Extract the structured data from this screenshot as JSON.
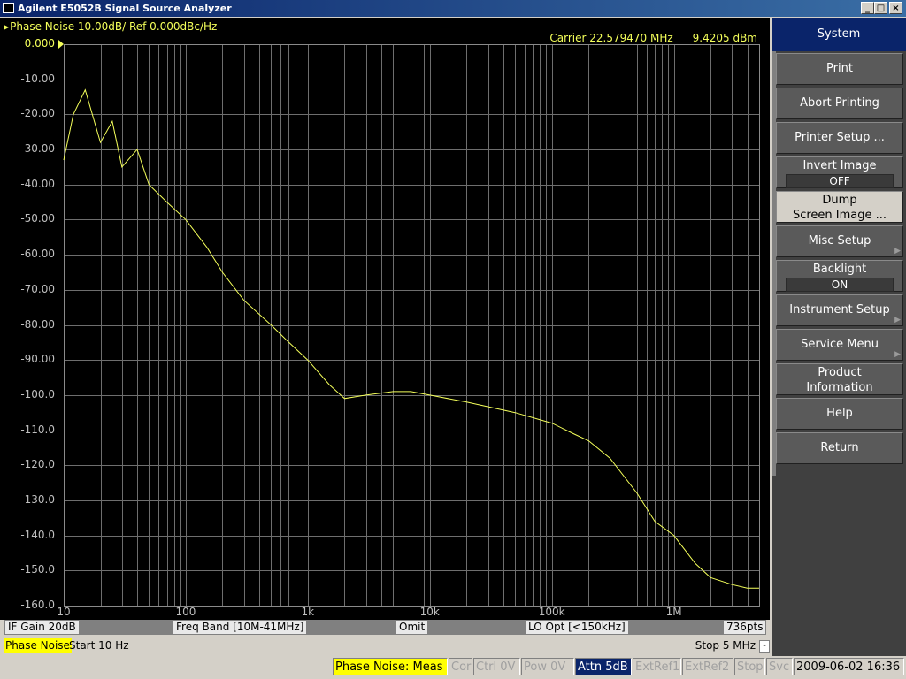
{
  "window": {
    "title": "Agilent E5052B Signal Source Analyzer",
    "controls": [
      "_",
      "□",
      "×"
    ]
  },
  "graph": {
    "trace_title": "Phase Noise 10.00dB/ Ref 0.000dBc/Hz",
    "carrier": {
      "frequency": "Carrier 22.579470 MHz",
      "power": "9.4205 dBm"
    },
    "y_ticks": [
      "0.000",
      "-10.00",
      "-20.00",
      "-30.00",
      "-40.00",
      "-50.00",
      "-60.00",
      "-70.00",
      "-80.00",
      "-90.00",
      "-100.0",
      "-110.0",
      "-120.0",
      "-130.0",
      "-140.0",
      "-150.0",
      "-160.0"
    ],
    "x_ticks": [
      "10",
      "100",
      "1k",
      "10k",
      "100k",
      "1M"
    ],
    "trace_color": "#f4ff5a"
  },
  "chart_data": {
    "type": "line",
    "title": "Phase Noise 10.00dB/ Ref 0.000dBc/Hz",
    "xlabel": "",
    "ylabel": "",
    "x_scale": "log",
    "xlim": [
      10,
      5000000
    ],
    "ylim": [
      -160,
      0
    ],
    "grid": true,
    "series": [
      {
        "x": [
          10,
          12,
          15,
          20,
          25,
          30,
          40,
          50,
          70,
          100,
          150,
          200,
          300,
          500,
          700,
          1000,
          1500,
          2000,
          3000,
          5000,
          7000,
          10000,
          20000,
          50000,
          100000,
          150000,
          200000,
          300000,
          500000,
          700000,
          1000000,
          1500000,
          2000000,
          3000000,
          4000000,
          5000000
        ],
        "y": [
          -33,
          -20,
          -13,
          -28,
          -22,
          -35,
          -30,
          -40,
          -45,
          -50,
          -58,
          -65,
          -73,
          -80,
          -85,
          -90,
          -97,
          -101,
          -100,
          -99,
          -99,
          -100,
          -102,
          -105,
          -108,
          -111,
          -113,
          -118,
          -128,
          -136,
          -140,
          -148,
          -152,
          -154,
          -155,
          -155
        ]
      }
    ]
  },
  "infobar": {
    "if_gain": "IF Gain 20dB",
    "freq_band": "Freq Band [10M-41MHz]",
    "omit": "Omit",
    "lo_opt": "LO Opt [<150kHz]",
    "points": "736pts"
  },
  "sweep": {
    "mode": "Phase Noise",
    "start": "Start 10 Hz",
    "stop": "Stop 5 MHz",
    "minus": "-"
  },
  "status": {
    "meas": "Phase Noise: Meas",
    "cor": "Cor",
    "ctrl": "Ctrl  0V",
    "pow": "Pow  0V",
    "attn": "Attn 5dB",
    "extref1": "ExtRef1",
    "extref2": "ExtRef2",
    "stop": "Stop",
    "svc": "Svc",
    "datetime": "2009-06-02 16:36"
  },
  "softkeys": {
    "title": "System",
    "print": "Print",
    "abort_printing": "Abort Printing",
    "printer_setup": "Printer Setup ...",
    "invert_image": {
      "label": "Invert Image",
      "value": "OFF"
    },
    "dump_screen": {
      "line1": "Dump",
      "line2": "Screen Image ..."
    },
    "misc_setup": "Misc Setup",
    "backlight": {
      "label": "Backlight",
      "value": "ON"
    },
    "instrument_setup": "Instrument Setup",
    "service_menu": "Service Menu",
    "product_info": {
      "line1": "Product",
      "line2": "Information"
    },
    "help": "Help",
    "return": "Return"
  }
}
